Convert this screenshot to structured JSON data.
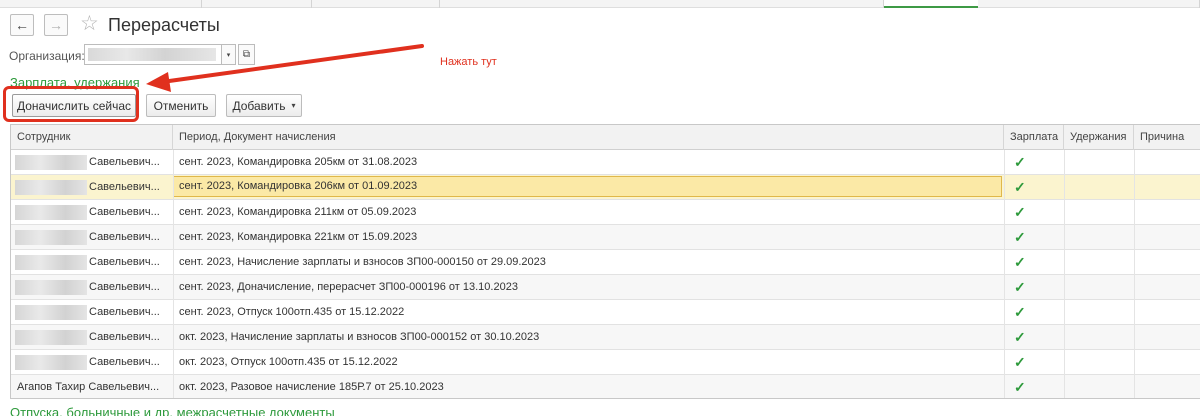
{
  "header": {
    "title": "Перерасчеты",
    "back_icon": "←",
    "forward_icon": "→",
    "star_icon": "☆"
  },
  "organization": {
    "label": "Организация:",
    "value": "",
    "dropdown_icon": "▾",
    "open_icon": "⧉"
  },
  "annotation": {
    "text": "Нажать тут",
    "color": "#e0301e"
  },
  "sections": {
    "top": "Зарплата, удержания",
    "bottom": "Отпуска, больничные и др. межрасчетные документы"
  },
  "toolbar": {
    "recalc_label": "Доначислить сейчас",
    "cancel_label": "Отменить",
    "add_label": "Добавить",
    "add_caret": "▾"
  },
  "table": {
    "columns": [
      "Сотрудник",
      "Период, Документ начисления",
      "Зарплата",
      "Удержания",
      "Причина"
    ],
    "rows": [
      {
        "employee": "Савельевич...",
        "period": "сент. 2023, Командировка 205км от 31.08.2023",
        "salary": "✓"
      },
      {
        "employee": "Савельевич...",
        "period": "сент. 2023, Командировка 206км от 01.09.2023",
        "salary": "✓"
      },
      {
        "employee": "Савельевич...",
        "period": "сент. 2023, Командировка 211км от 05.09.2023",
        "salary": "✓"
      },
      {
        "employee": "Савельевич...",
        "period": "сент. 2023, Командировка 221км от 15.09.2023",
        "salary": "✓"
      },
      {
        "employee": "Савельевич...",
        "period": "сент. 2023, Начисление зарплаты и взносов ЗП00-000150 от 29.09.2023",
        "salary": "✓"
      },
      {
        "employee": "Савельевич...",
        "period": "сент. 2023, Доначисление, перерасчет ЗП00-000196 от 13.10.2023",
        "salary": "✓"
      },
      {
        "employee": "Савельевич...",
        "period": "сент. 2023, Отпуск 100отп.435 от 15.12.2022",
        "salary": "✓"
      },
      {
        "employee": "Савельевич...",
        "period": "окт. 2023, Начисление зарплаты и взносов ЗП00-000152 от 30.10.2023",
        "salary": "✓"
      },
      {
        "employee": "Савельевич...",
        "period": "окт. 2023, Отпуск 100отп.435 от 15.12.2022",
        "salary": "✓"
      },
      {
        "employee": "Агапов Тахир Савельевич...",
        "period": "окт. 2023, Разовое начисление 185Р.7 от 25.10.2023",
        "salary": "✓"
      }
    ],
    "selected_row": 2
  },
  "colors": {
    "accent_green": "#2e9a3c",
    "highlight_red": "#e0301e",
    "selected_row": "#fbf4cf"
  }
}
